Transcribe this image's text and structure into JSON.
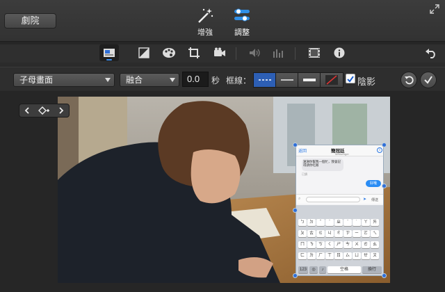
{
  "topbar": {
    "theater_label": "劇院",
    "enhance_label": "增強",
    "adjust_label": "調整"
  },
  "toolbar": {
    "icons": [
      "picture-in-picture-icon",
      "color-balance-icon",
      "color-correction-icon",
      "crop-icon",
      "stabilization-icon",
      "volume-icon",
      "equalizer-icon",
      "clip-filter-icon",
      "info-icon",
      "undo-icon"
    ]
  },
  "controls": {
    "layout_select": "子母畫面",
    "transition_select": "融合",
    "duration_value": "0.0",
    "duration_unit": "秒",
    "border_label": "框線：",
    "shadow_label": "陰影",
    "shadow_checked": true
  },
  "pip": {
    "back_label": "返回",
    "contact_name": "簡冠廷",
    "subtitle": "Messenger",
    "message_text": "謝謝你幫我一個忙，我會記得請你吃飯",
    "seen_text": "已讀",
    "reply_text": "好哦",
    "send_label": "傳送",
    "space_label": "空格",
    "enter_label": "換行",
    "num_label": "123"
  },
  "colors": {
    "accent": "#3a8ef0",
    "selected_segment": "#2d5fb5",
    "handle": "#2f6fd8"
  }
}
